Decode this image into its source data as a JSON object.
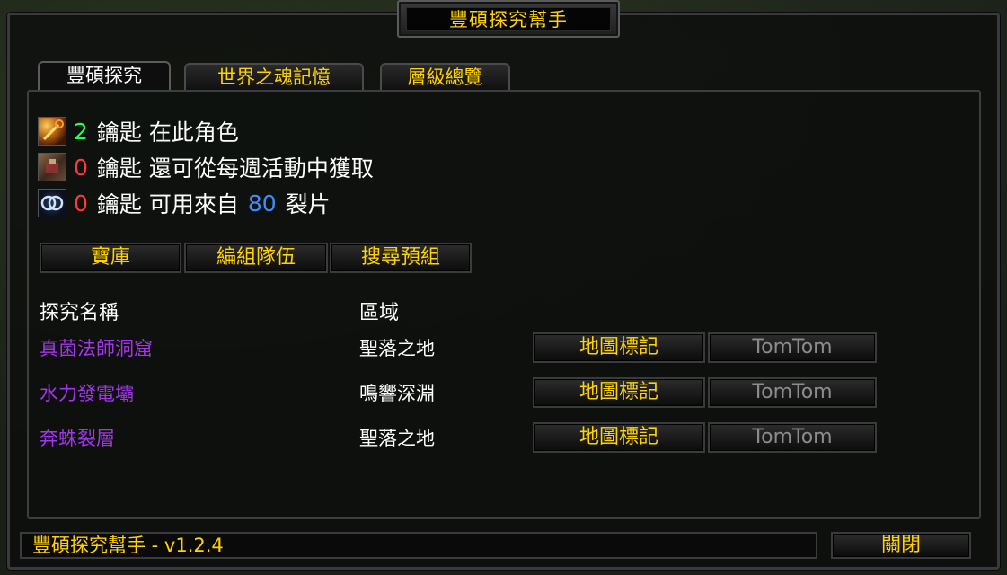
{
  "window": {
    "title": "豐碩探究幫手"
  },
  "tabs": [
    {
      "label": "豐碩探究",
      "active": true
    },
    {
      "label": "世界之魂記憶",
      "active": false
    },
    {
      "label": "層級總覽",
      "active": false
    }
  ],
  "keys": [
    {
      "icon": "key-icon",
      "count": "2",
      "label": "鑰匙 在此角色",
      "color": "#1eff4e"
    },
    {
      "icon": "weekly-activity-icon",
      "count": "0",
      "label": "鑰匙 還可從每週活動中獲取",
      "color": "#ff3a3a"
    },
    {
      "icon": "shard-icon",
      "count": "0",
      "label_before": "鑰匙 可用來自",
      "shards": "80",
      "label_after": "裂片",
      "color": "#ff3a3a",
      "shards_color": "#3e8dff"
    }
  ],
  "actions": {
    "vault": "寶庫",
    "group": "編組隊伍",
    "premade": "搜尋預組"
  },
  "table": {
    "headers": {
      "name": "探究名稱",
      "zone": "區域"
    },
    "rows": [
      {
        "name": "真菌法師洞窟",
        "zone": "聖落之地",
        "waypoint": "地圖標記",
        "tomtom": "TomTom"
      },
      {
        "name": "水力發電壩",
        "zone": "鳴響深淵",
        "waypoint": "地圖標記",
        "tomtom": "TomTom"
      },
      {
        "name": "奔蛛裂層",
        "zone": "聖落之地",
        "waypoint": "地圖標記",
        "tomtom": "TomTom"
      }
    ]
  },
  "footer": {
    "status": "豐碩探究幫手 - v1.2.4",
    "close": "關閉"
  },
  "colors": {
    "gold": "#ffd200",
    "epic_purple": "#a335ee"
  }
}
